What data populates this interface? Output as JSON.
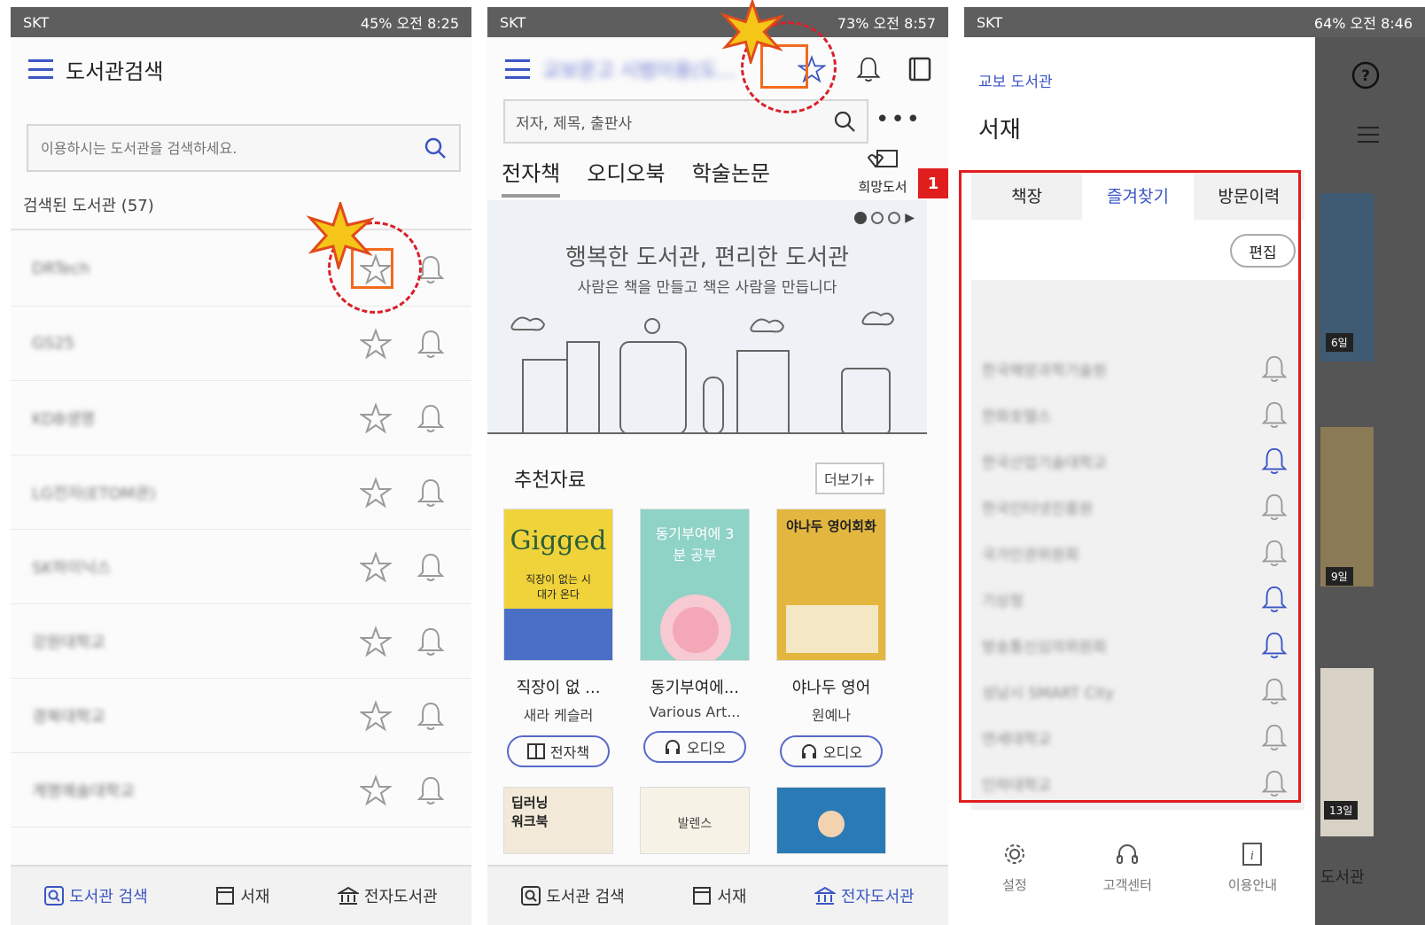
{
  "status_bar": {
    "p1": {
      "carrier": "SKT",
      "right": "45% 오전 8:25"
    },
    "p2": {
      "carrier": "SKT",
      "right": "73% 오전 8:57"
    },
    "p3": {
      "carrier": "SKT",
      "right": "64% 오전 8:46"
    }
  },
  "panel1": {
    "title": "도서관검색",
    "search_placeholder": "이용하시는 도서관을 검색하세요.",
    "result_count": "검색된 도서관 (57)",
    "libraries": [
      "DRTech",
      "GS25",
      "KDB생명",
      "LG전자(ETOM관)",
      "SK하이닉스",
      "강원대학교",
      "경북대학교",
      "계명예술대학교"
    ]
  },
  "panel2": {
    "title": "교보문고 시범이용(도...",
    "search_label": "저자, 제목, 출판사",
    "tabs": [
      "전자책",
      "오디오북",
      "학술논문"
    ],
    "hope_label": "희망도서",
    "banner_title": "행복한 도서관, 편리한 도서관",
    "banner_sub": "사람은 책을 만들고 책은 사람을 만듭니다",
    "recommend_title": "추천자료",
    "more_label": "더보기+",
    "books": [
      {
        "title": "직장이 없 ...",
        "author": "새라 케슬러",
        "badge": "전자책"
      },
      {
        "title": "동기부여에...",
        "author": "Various Art...",
        "badge": "오디오"
      },
      {
        "title": "야나두 영어",
        "author": "원예나",
        "badge": "오디오"
      }
    ],
    "cover_texts": {
      "book1_top": "Gigged",
      "book1_sub": "직장이 없는 시대가 온다",
      "book2": "동기부여에 3분 공부",
      "book3": "야나두 영어회화",
      "book4": "딥러닝 워크북",
      "book5": "발렌스"
    }
  },
  "panel3": {
    "brand": "교보 도서관",
    "title": "서재",
    "tabs": [
      "책장",
      "즐겨찾기",
      "방문이력"
    ],
    "active_tab": "즐겨찾기",
    "edit_label": "편집",
    "favorites": [
      "한국해양과학기술원",
      "한화호텔스",
      "한국산업기술대학교",
      "한국인터넷진흥원",
      "국가인권위원회",
      "기상청",
      "방송통신심의위원회",
      "성남시 SMART City",
      "연세대학교",
      "인하대학교"
    ],
    "bell_active_indices": [
      2,
      5,
      6
    ],
    "footer": [
      "설정",
      "고객센터",
      "이용안내"
    ],
    "side_badges": [
      "6일",
      "9일",
      "13일"
    ],
    "side_text": "도서관"
  },
  "bottom_nav": [
    "도서관 검색",
    "서재",
    "전자도서관"
  ],
  "annotations": {
    "label_1": "1"
  },
  "colors": {
    "accent": "#3b55c4",
    "highlight_red": "#e01e1e",
    "highlight_orange": "#f26b1d",
    "star": "#f5c518"
  }
}
